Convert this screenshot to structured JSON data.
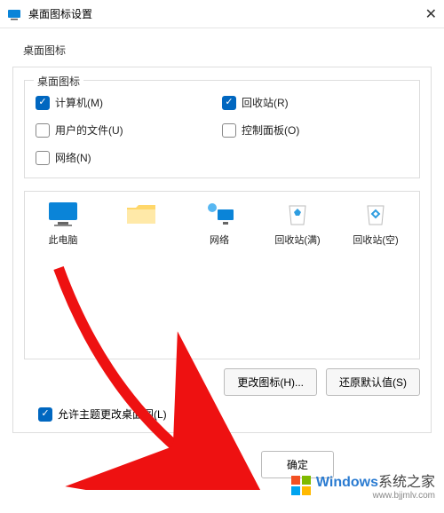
{
  "titlebar": {
    "title": "桌面图标设置"
  },
  "tab": {
    "label": "桌面图标"
  },
  "fieldset": {
    "legend": "桌面图标"
  },
  "checkboxes": {
    "computer": {
      "label": "计算机(M)",
      "checked": true
    },
    "recyclebin": {
      "label": "回收站(R)",
      "checked": true
    },
    "userfiles": {
      "label": "用户的文件(U)",
      "checked": false
    },
    "controlpanel": {
      "label": "控制面板(O)",
      "checked": false
    },
    "network": {
      "label": "网络(N)",
      "checked": false
    }
  },
  "icons": {
    "thispc": "此电脑",
    "unnamed": " ",
    "network": "网络",
    "recyclefull": "回收站(满)",
    "recycleempty": "回收站(空)"
  },
  "buttons": {
    "changeIcon": "更改图标(H)...",
    "restoreDefault": "还原默认值(S)",
    "ok": "确定"
  },
  "allowThemeChange": {
    "label": "允许主题更改桌面图",
    "suffix": "(L)",
    "checked": true
  },
  "watermark": {
    "brand": "Windows",
    "site": "系统之家",
    "url": "www.bjjmlv.com"
  }
}
